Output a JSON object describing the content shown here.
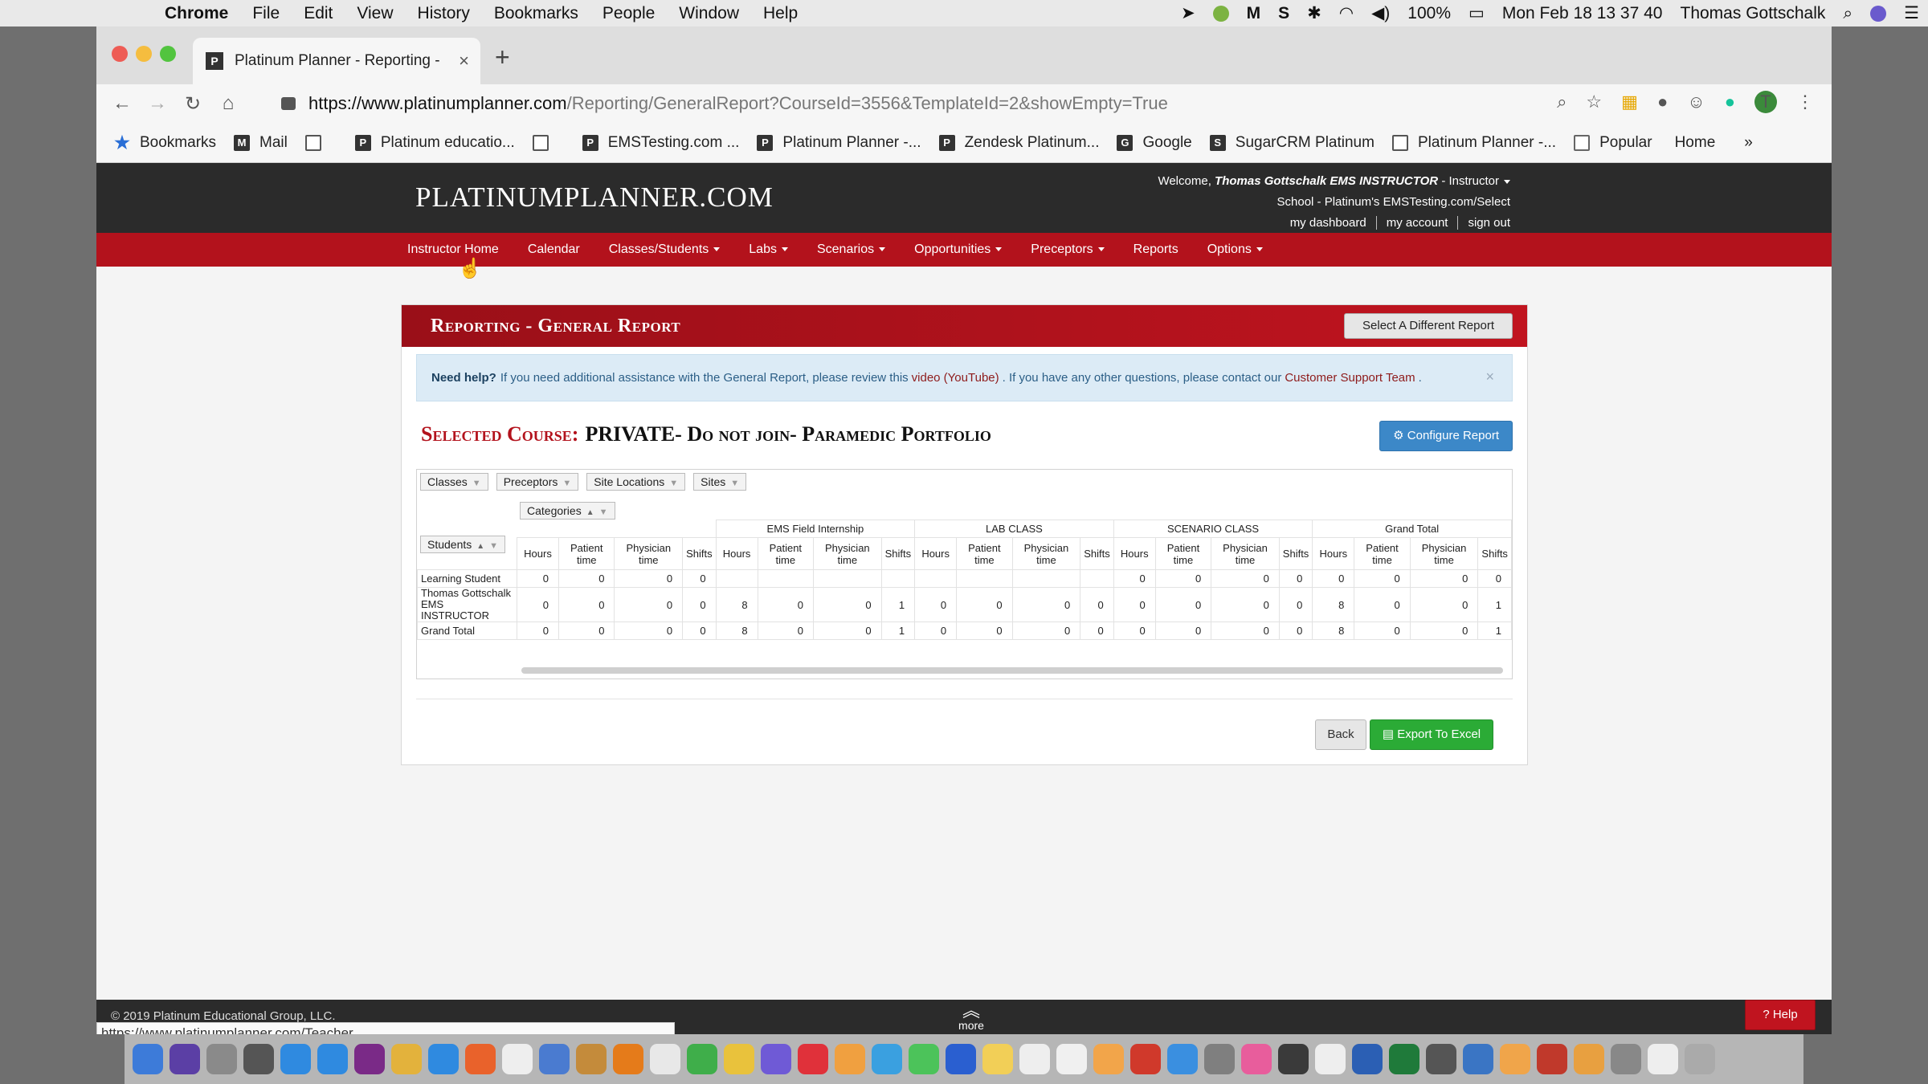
{
  "menubar": {
    "items": [
      "Chrome",
      "File",
      "Edit",
      "View",
      "History",
      "Bookmarks",
      "People",
      "Window",
      "Help"
    ],
    "battery": "100%",
    "clock": "Mon Feb 18  13 37 40",
    "user": "Thomas Gottschalk"
  },
  "browser": {
    "tab_title": "Platinum Planner - Reporting -",
    "tab_favicon": "P",
    "url_host": "https://www.platinumplanner.com",
    "url_path": "/Reporting/GeneralReport?CourseId=3556&TemplateId=2&showEmpty=True",
    "avatar_letter": "T",
    "bookmarks": [
      {
        "label": "Bookmarks",
        "icon": "star"
      },
      {
        "label": "Mail",
        "icon": "M"
      },
      {
        "label": "",
        "icon": "doc"
      },
      {
        "label": "Platinum educatio...",
        "icon": "P"
      },
      {
        "label": "",
        "icon": "doc"
      },
      {
        "label": "EMSTesting.com ...",
        "icon": "P"
      },
      {
        "label": "Platinum Planner -...",
        "icon": "P"
      },
      {
        "label": "Zendesk Platinum...",
        "icon": "P"
      },
      {
        "label": "Google",
        "icon": "G"
      },
      {
        "label": "SugarCRM Platinum",
        "icon": "S"
      },
      {
        "label": "Platinum Planner -...",
        "icon": "doc"
      },
      {
        "label": "Popular",
        "icon": "folder"
      }
    ],
    "bookmarks_home": "Home",
    "bookmarks_overflow": "»",
    "status_url": "https://www.platinumplanner.com/Teacher"
  },
  "header": {
    "logo": "PLATINUMPLANNER.COM",
    "welcome_prefix": "Welcome,",
    "welcome_name": "Thomas Gottschalk EMS INSTRUCTOR",
    "welcome_role": "- Instructor",
    "school": "School - Platinum's EMSTesting.com/Select",
    "links": [
      "my dashboard",
      "my account",
      "sign out"
    ]
  },
  "nav": [
    {
      "label": "Instructor Home",
      "dropdown": false
    },
    {
      "label": "Calendar",
      "dropdown": false
    },
    {
      "label": "Classes/Students",
      "dropdown": true
    },
    {
      "label": "Labs",
      "dropdown": true
    },
    {
      "label": "Scenarios",
      "dropdown": true
    },
    {
      "label": "Opportunities",
      "dropdown": true
    },
    {
      "label": "Preceptors",
      "dropdown": true
    },
    {
      "label": "Reports",
      "dropdown": false
    },
    {
      "label": "Options",
      "dropdown": true
    }
  ],
  "panel": {
    "title": "Reporting - General Report",
    "select_report_label": "Select A Different Report",
    "help": {
      "lead": "Need help?",
      "text1": "If you need additional assistance with the General Report, please review this",
      "video_link": "video (YouTube)",
      "text2": ". If you have any other questions, please contact our",
      "support_link": "Customer Support Team",
      "text3": ".",
      "close": "×"
    },
    "course_label": "Selected Course:",
    "course_name": "PRIVATE- Do not join- Paramedic Portfolio",
    "configure_label": "Configure Report",
    "back_label": "Back",
    "export_label": "Export To Excel"
  },
  "pivot": {
    "filters": [
      "Classes",
      "Preceptors",
      "Site Locations",
      "Sites"
    ],
    "categories_label": "Categories",
    "students_label": "Students",
    "groups": [
      {
        "name": "",
        "span": 4
      },
      {
        "name": "EMS Field Internship",
        "span": 4
      },
      {
        "name": "LAB CLASS",
        "span": 4
      },
      {
        "name": "SCENARIO CLASS",
        "span": 4
      },
      {
        "name": "Grand Total",
        "span": 4
      }
    ],
    "subcols": [
      "Hours",
      "Patient time",
      "Physician time",
      "Shifts"
    ],
    "rows": [
      {
        "label": "Learning Student",
        "values": [
          "0",
          "0",
          "0",
          "0",
          "",
          "",
          "",
          "",
          "",
          "",
          "",
          "",
          "0",
          "0",
          "0",
          "0",
          "0",
          "0",
          "0",
          "0"
        ]
      },
      {
        "label": "Thomas Gottschalk EMS INSTRUCTOR",
        "values": [
          "0",
          "0",
          "0",
          "0",
          "8",
          "0",
          "0",
          "1",
          "0",
          "0",
          "0",
          "0",
          "0",
          "0",
          "0",
          "0",
          "8",
          "0",
          "0",
          "1"
        ]
      },
      {
        "label": "Grand Total",
        "values": [
          "0",
          "0",
          "0",
          "0",
          "8",
          "0",
          "0",
          "1",
          "0",
          "0",
          "0",
          "0",
          "0",
          "0",
          "0",
          "0",
          "8",
          "0",
          "0",
          "1"
        ]
      }
    ]
  },
  "footer": {
    "copyright": "© 2019 Platinum Educational Group, LLC.",
    "more": "more",
    "help": "Help"
  }
}
